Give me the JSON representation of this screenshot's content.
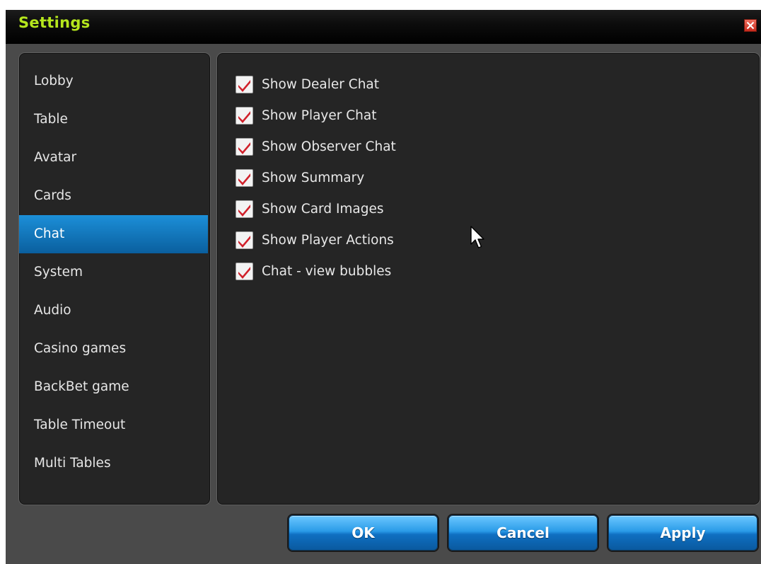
{
  "window": {
    "title": "Settings",
    "accent_color": "#b5e61d",
    "close_icon": "close-icon"
  },
  "sidebar": {
    "items": [
      {
        "label": "Lobby",
        "active": false
      },
      {
        "label": "Table",
        "active": false
      },
      {
        "label": "Avatar",
        "active": false
      },
      {
        "label": "Cards",
        "active": false
      },
      {
        "label": "Chat",
        "active": true
      },
      {
        "label": "System",
        "active": false
      },
      {
        "label": "Audio",
        "active": false
      },
      {
        "label": "Casino games",
        "active": false
      },
      {
        "label": "BackBet game",
        "active": false
      },
      {
        "label": "Table Timeout",
        "active": false
      },
      {
        "label": "Multi Tables",
        "active": false
      }
    ],
    "active_color": "#1c8fd8"
  },
  "chat_options": [
    {
      "label": "Show Dealer Chat",
      "checked": true
    },
    {
      "label": "Show Player Chat",
      "checked": true
    },
    {
      "label": "Show Observer Chat",
      "checked": true
    },
    {
      "label": "Show Summary",
      "checked": true
    },
    {
      "label": "Show Card Images",
      "checked": true
    },
    {
      "label": "Show Player Actions",
      "checked": true
    },
    {
      "label": "Chat - view bubbles",
      "checked": true
    }
  ],
  "checkmark_color": "#d0202a",
  "buttons": {
    "ok_label": "OK",
    "cancel_label": "Cancel",
    "apply_label": "Apply",
    "color": "#2a9be8"
  }
}
